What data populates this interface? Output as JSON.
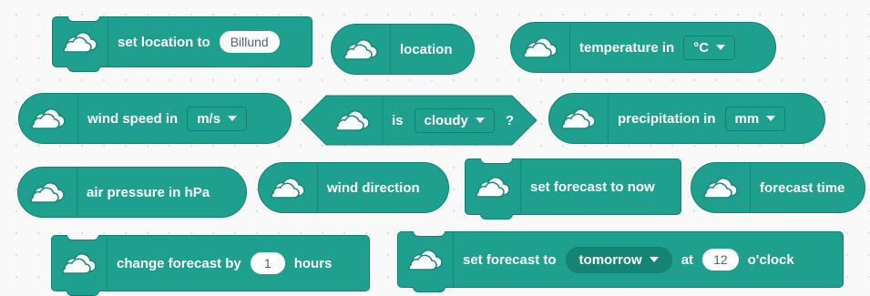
{
  "blocks": {
    "set_location": {
      "label": "set location to",
      "value": "Billund"
    },
    "location": {
      "label": "location"
    },
    "temperature": {
      "label": "temperature in",
      "unit": "°C"
    },
    "wind_speed": {
      "label": "wind speed in",
      "unit": "m/s"
    },
    "is_cloudy": {
      "label": "is",
      "condition": "cloudy",
      "suffix": "?"
    },
    "precipitation": {
      "label": "precipitation in",
      "unit": "mm"
    },
    "air_pressure": {
      "label": "air pressure in hPa"
    },
    "wind_direction": {
      "label": "wind direction"
    },
    "set_forecast_now": {
      "label": "set forecast to now"
    },
    "forecast_time": {
      "label": "forecast time"
    },
    "change_forecast": {
      "label": "change forecast by",
      "value": "1",
      "suffix": "hours"
    },
    "set_forecast_to": {
      "label": "set forecast to",
      "day": "tomorrow",
      "at": "at",
      "hour": "12",
      "suffix": "o'clock"
    }
  },
  "colors": {
    "block": "#1fa08e",
    "border": "#14806f",
    "canvas": "#f9f9fa"
  },
  "icon": "cloud-icon"
}
